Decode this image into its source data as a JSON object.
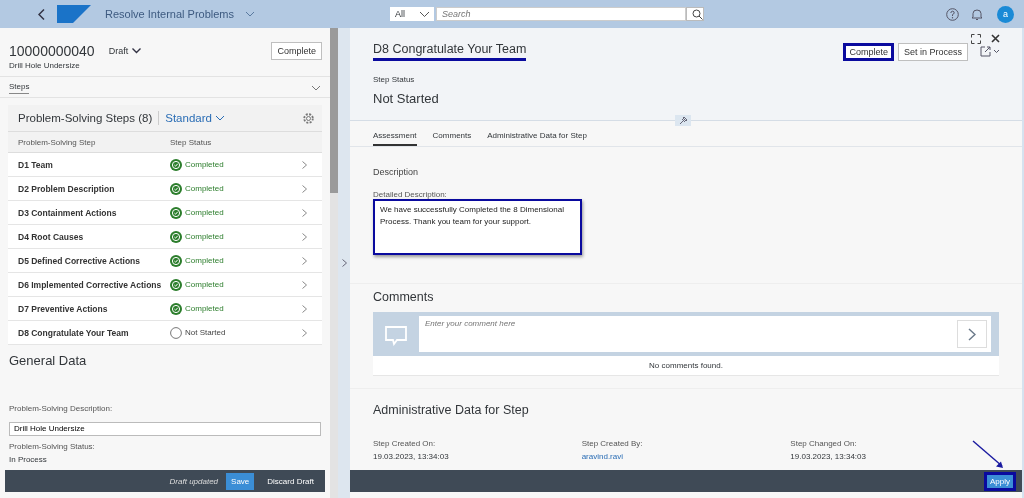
{
  "shell": {
    "title": "Resolve Internal Problems",
    "search_scope": "All",
    "search_placeholder": "Search",
    "avatar": "a"
  },
  "object": {
    "id": "10000000040",
    "status": "Draft",
    "subtitle": "Drill Hole Undersize",
    "action": "Complete",
    "section_tab": "Steps"
  },
  "steps_table": {
    "title": "Problem-Solving Steps (8)",
    "variant": "Standard",
    "columns": [
      "Problem-Solving Step",
      "Step Status"
    ],
    "rows": [
      {
        "step": "D1 Team",
        "status": "Completed",
        "completed": true
      },
      {
        "step": "D2 Problem Description",
        "status": "Completed",
        "completed": true
      },
      {
        "step": "D3 Containment Actions",
        "status": "Completed",
        "completed": true
      },
      {
        "step": "D4 Root Causes",
        "status": "Completed",
        "completed": true
      },
      {
        "step": "D5 Defined Corrective Actions",
        "status": "Completed",
        "completed": true
      },
      {
        "step": "D6 Implemented Corrective Actions",
        "status": "Completed",
        "completed": true
      },
      {
        "step": "D7 Preventive Actions",
        "status": "Completed",
        "completed": true
      },
      {
        "step": "D8 Congratulate Your Team",
        "status": "Not Started",
        "completed": false
      }
    ]
  },
  "general_data": {
    "title": "General Data",
    "description_label": "Problem-Solving Description:",
    "description_value": "Drill Hole Undersize",
    "status_label": "Problem-Solving Status:",
    "status_value": "In Process"
  },
  "left_footer": {
    "message": "Draft updated",
    "buttons": [
      "Save",
      "Discard Draft"
    ]
  },
  "detail": {
    "title": "D8 Congratulate Your Team",
    "title_underlined": true,
    "actions": [
      {
        "label": "Complete",
        "highlighted": true
      },
      {
        "label": "Set in Process",
        "highlighted": false
      }
    ],
    "status_label": "Step Status",
    "status_value": "Not Started",
    "tabs": [
      {
        "label": "Assessment",
        "selected": true
      },
      {
        "label": "Comments",
        "selected": false
      },
      {
        "label": "Administrative Data for Step",
        "selected": false
      }
    ],
    "description": {
      "heading": "Description",
      "label": "Detailed Description:",
      "value": "We have successfully  Completed the 8 Dimensional Process. Thank you team for your support.",
      "highlighted": true
    },
    "comments": {
      "heading": "Comments",
      "placeholder": "Enter your comment here",
      "empty_text": "No comments found."
    },
    "admin": {
      "heading": "Administrative Data for Step",
      "fields": [
        {
          "label": "Step Created On:",
          "value": "19.03.2023, 13:34:03",
          "link": false
        },
        {
          "label": "Step Created By:",
          "value": "aravind.ravi",
          "link": true
        },
        {
          "label": "Step Changed On:",
          "value": "19.03.2023, 13:34:03",
          "link": false
        }
      ]
    }
  },
  "right_footer": {
    "button": "Apply",
    "highlighted": true
  }
}
